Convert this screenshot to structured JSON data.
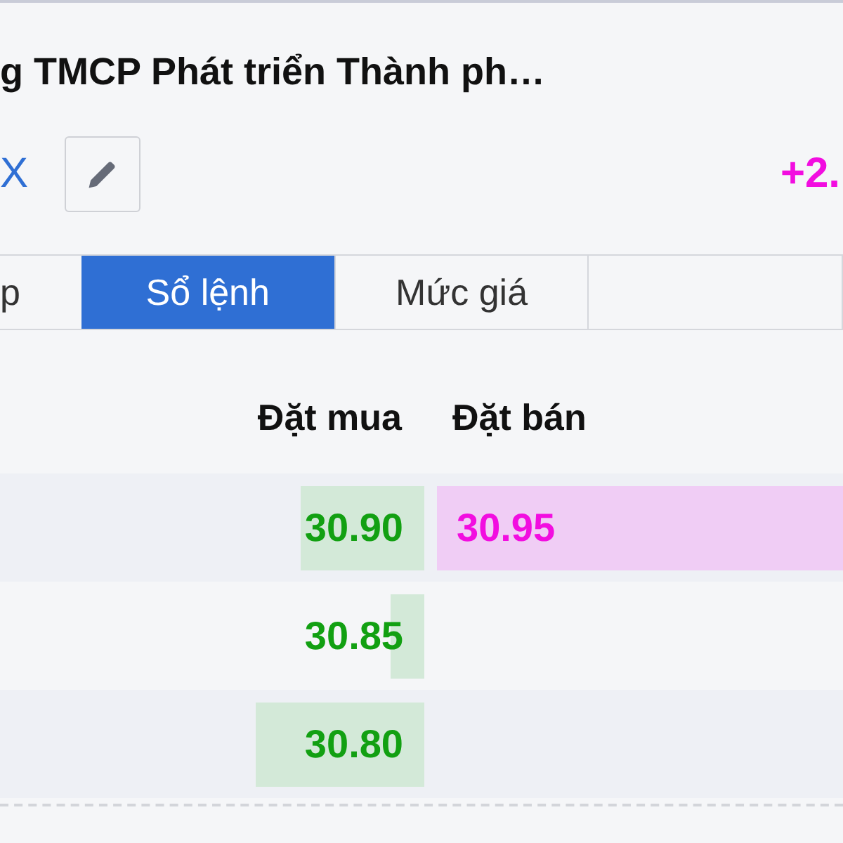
{
  "header": {
    "title": "g TMCP Phát triển Thành ph…",
    "exchange": "X",
    "change": "+2."
  },
  "tabs": [
    {
      "label": "p",
      "selected": false
    },
    {
      "label": "Sổ lệnh",
      "selected": true
    },
    {
      "label": "Mức giá",
      "selected": false
    },
    {
      "selected": false
    }
  ],
  "order_book": {
    "columns": [
      "Đặt mua",
      "Đặt bán"
    ],
    "rows": [
      {
        "bid": "30.90",
        "ask": "30.95"
      },
      {
        "bid": "30.85"
      },
      {
        "bid": "30.80"
      }
    ]
  }
}
